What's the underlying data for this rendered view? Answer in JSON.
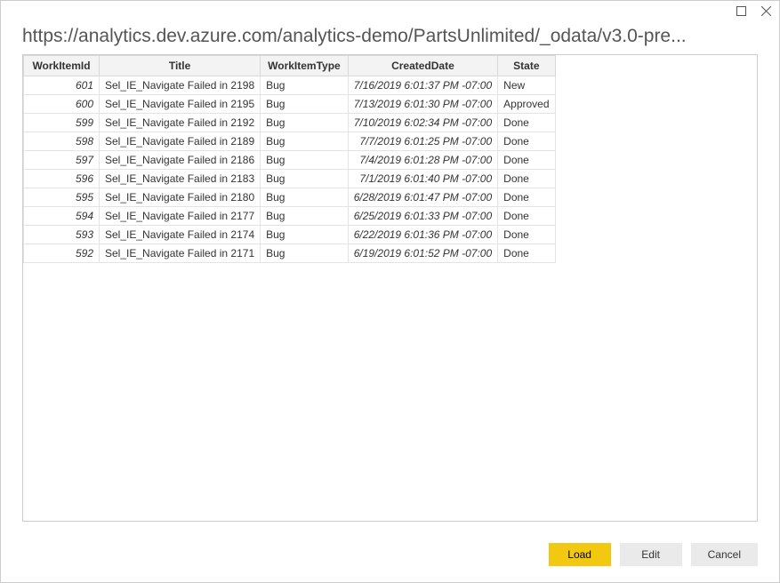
{
  "titlebar": {
    "maximize_icon": "maximize",
    "close_icon": "close"
  },
  "header": {
    "title": "https://analytics.dev.azure.com/analytics-demo/PartsUnlimited/_odata/v3.0-pre..."
  },
  "table": {
    "columns": [
      "WorkItemId",
      "Title",
      "WorkItemType",
      "CreatedDate",
      "State"
    ],
    "rows": [
      {
        "id": "601",
        "title": "Sel_IE_Navigate Failed in 2198",
        "type": "Bug",
        "created": "7/16/2019 6:01:37 PM -07:00",
        "state": "New"
      },
      {
        "id": "600",
        "title": "Sel_IE_Navigate Failed in 2195",
        "type": "Bug",
        "created": "7/13/2019 6:01:30 PM -07:00",
        "state": "Approved"
      },
      {
        "id": "599",
        "title": "Sel_IE_Navigate Failed in 2192",
        "type": "Bug",
        "created": "7/10/2019 6:02:34 PM -07:00",
        "state": "Done"
      },
      {
        "id": "598",
        "title": "Sel_IE_Navigate Failed in 2189",
        "type": "Bug",
        "created": "7/7/2019 6:01:25 PM -07:00",
        "state": "Done"
      },
      {
        "id": "597",
        "title": "Sel_IE_Navigate Failed in 2186",
        "type": "Bug",
        "created": "7/4/2019 6:01:28 PM -07:00",
        "state": "Done"
      },
      {
        "id": "596",
        "title": "Sel_IE_Navigate Failed in 2183",
        "type": "Bug",
        "created": "7/1/2019 6:01:40 PM -07:00",
        "state": "Done"
      },
      {
        "id": "595",
        "title": "Sel_IE_Navigate Failed in 2180",
        "type": "Bug",
        "created": "6/28/2019 6:01:47 PM -07:00",
        "state": "Done"
      },
      {
        "id": "594",
        "title": "Sel_IE_Navigate Failed in 2177",
        "type": "Bug",
        "created": "6/25/2019 6:01:33 PM -07:00",
        "state": "Done"
      },
      {
        "id": "593",
        "title": "Sel_IE_Navigate Failed in 2174",
        "type": "Bug",
        "created": "6/22/2019 6:01:36 PM -07:00",
        "state": "Done"
      },
      {
        "id": "592",
        "title": "Sel_IE_Navigate Failed in 2171",
        "type": "Bug",
        "created": "6/19/2019 6:01:52 PM -07:00",
        "state": "Done"
      }
    ]
  },
  "footer": {
    "load_label": "Load",
    "edit_label": "Edit",
    "cancel_label": "Cancel"
  }
}
